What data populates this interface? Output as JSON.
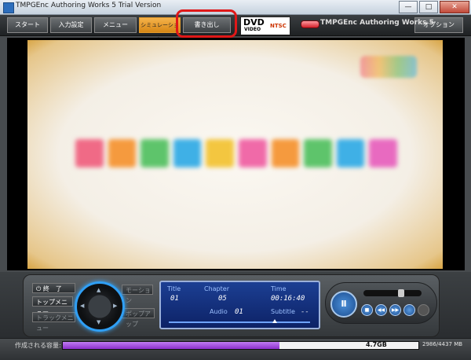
{
  "window": {
    "title": "TMPGEnc Authoring Works 5 Trial Version",
    "minimize": "—",
    "maximize": "□",
    "close": "✕"
  },
  "toolbar": {
    "start": "スタート",
    "input": "入力設定",
    "menu": "メニュー",
    "simulation": "シミュレーション",
    "output": "書き出し",
    "options": "オプション"
  },
  "badge": {
    "dvd": "DVD",
    "video": "VIDEO",
    "ntsc": "NTSC",
    "brand": "TMPGEnc Authoring Works 5"
  },
  "preview": {
    "menu_tile_colors": [
      "#f06a86",
      "#f59a3e",
      "#5ec46b",
      "#3fb0e6",
      "#f3c640",
      "#f06aa8",
      "#f59a3e",
      "#5ec46b",
      "#3fb0e6",
      "#e86ac0"
    ]
  },
  "controls": {
    "end": "終　了",
    "top_menu": "トップメニュー",
    "track_menu": "トラックメニュー",
    "motion": "モーション",
    "popup": "ポップアップ",
    "icons": {
      "power": "⏻",
      "play_pause": "Ⅱ",
      "stop": "■",
      "rewind": "◀◀",
      "forward": "▶▶"
    }
  },
  "lcd": {
    "title_label": "Title",
    "title_value": "01",
    "chapter_label": "Chapter",
    "chapter_value": "05",
    "time_label": "Time",
    "time_value": "00:16:40",
    "audio_label": "Audio",
    "audio_value": "01",
    "subtitle_label": "Subtitle",
    "subtitle_value": "--",
    "progress": 0.75
  },
  "status": {
    "label": "作成される容量:",
    "fill_ratio": 0.61,
    "marker": "4.7GB",
    "total": "2986/4437 MB"
  }
}
